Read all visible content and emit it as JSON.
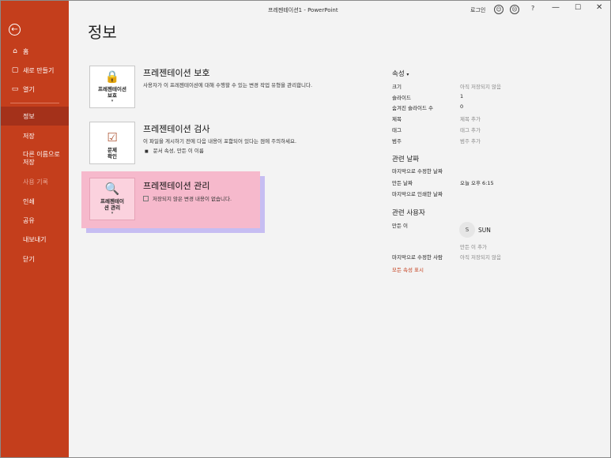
{
  "titlebar": {
    "title": "프레젠테이션1  -  PowerPoint",
    "login": "로그인",
    "smile_icon": "☺",
    "frown_icon": "☹",
    "help": "?",
    "minimize": "—",
    "maximize": "☐",
    "close": "✕"
  },
  "sidebar": {
    "back_icon": "←",
    "items": [
      {
        "label": "홈",
        "icon": "⌂"
      },
      {
        "label": "새로 만들기",
        "icon": "▢"
      },
      {
        "label": "열기",
        "icon": "▭"
      },
      {
        "label": "정보"
      },
      {
        "label": "저장"
      },
      {
        "label": "다른 이름으로\n저장"
      },
      {
        "label": "사용 기록"
      },
      {
        "label": "인쇄"
      },
      {
        "label": "공유"
      },
      {
        "label": "내보내기"
      },
      {
        "label": "닫기"
      }
    ],
    "active_item": "정보"
  },
  "main": {
    "page_title": "정보",
    "sections": [
      {
        "card_label": "프레젠테이션\n보호",
        "card_icon": "🔒",
        "title": "프레젠테이션 보호",
        "desc": "사용자가 이 프레젠테이션에 대해 수행할 수 있는 변경 작업 유형을 관리합니다."
      },
      {
        "card_label": "문제\n확인",
        "card_icon": "☑",
        "title": "프레젠테이션 검사",
        "desc": "이 파일을 게시하기 전에 다음 내용이 포함되어 있다는 점에 주의하세요.",
        "bullets": [
          "문서 속성, 만든 이 이름"
        ]
      },
      {
        "card_label": "프레젠테이\n션 관리",
        "card_icon": "🔍",
        "title": "프레젠테이션 관리",
        "desc": "저장되지 않은 변경 내용이 없습니다."
      }
    ]
  },
  "properties": {
    "header": "속성 ",
    "rows": [
      {
        "label": "크기",
        "value": "아직 저장되지 않음"
      },
      {
        "label": "슬라이드",
        "value": "1"
      },
      {
        "label": "숨겨진 슬라이드 수",
        "value": "0"
      },
      {
        "label": "제목",
        "value": "제목 추가"
      },
      {
        "label": "태그",
        "value": "태그 추가"
      },
      {
        "label": "범주",
        "value": "범주 추가"
      }
    ],
    "dates_header": "관련 날짜",
    "dates": [
      {
        "label": "마지막으로 수정한 날짜",
        "value": ""
      },
      {
        "label": "만든 날짜",
        "value": "오늘 오후 6:15"
      },
      {
        "label": "마지막으로 인쇄한 날짜",
        "value": ""
      }
    ],
    "people_header": "관련 사용자",
    "author_label": "만든 이",
    "author_initial": "S",
    "author_name": "SUN",
    "add_author": "만든 이 추가",
    "last_modified_by_label": "마지막으로 수정한 사람",
    "last_modified_by_value": "아직 저장되지 않음",
    "show_all": "모든 속성 표시"
  }
}
